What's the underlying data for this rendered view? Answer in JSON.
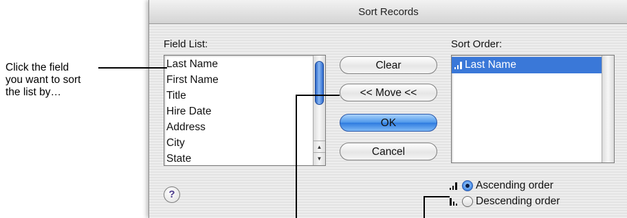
{
  "callout": {
    "lines": [
      "Click the field",
      "you want to sort",
      "the list by…"
    ]
  },
  "dialog": {
    "title": "Sort Records",
    "field_list_label": "Field List:",
    "sort_order_label": "Sort Order:",
    "fields": [
      "Last Name",
      "First Name",
      "Title",
      "Hire Date",
      "Address",
      "City",
      "State"
    ],
    "sort_order_items": [
      "Last Name"
    ],
    "buttons": {
      "clear": "Clear",
      "move": "<< Move <<",
      "ok": "OK",
      "cancel": "Cancel"
    },
    "help_label": "?",
    "order_options": {
      "ascending": "Ascending order",
      "descending": "Descending order",
      "selected": "ascending"
    }
  },
  "colors": {
    "selection": "#3a78d8",
    "default_button": "#4c97ea"
  },
  "icons": [
    "ascending-bars-icon",
    "descending-bars-icon",
    "help-icon"
  ]
}
